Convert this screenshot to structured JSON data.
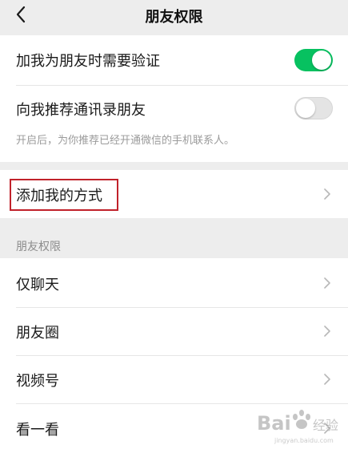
{
  "nav": {
    "title": "朋友权限",
    "back_icon": "chevron-left-icon"
  },
  "verification": {
    "require_verification_label": "加我为朋友时需要验证",
    "require_verification_on": true,
    "recommend_contacts_label": "向我推荐通讯录朋友",
    "recommend_contacts_on": false,
    "recommend_contacts_hint": "开启后，为你推荐已经开通微信的手机联系人。"
  },
  "add_me": {
    "label": "添加我的方式",
    "chevron_icon": "chevron-right-icon"
  },
  "permissions": {
    "header": "朋友权限",
    "items": [
      {
        "label": "仅聊天"
      },
      {
        "label": "朋友圈"
      },
      {
        "label": "视频号"
      },
      {
        "label": "看一看"
      }
    ]
  },
  "watermark": {
    "text": "Bai 经验"
  },
  "colors": {
    "accent_green": "#07c160",
    "highlight_red": "#c1222b",
    "page_background": "#ededed"
  }
}
